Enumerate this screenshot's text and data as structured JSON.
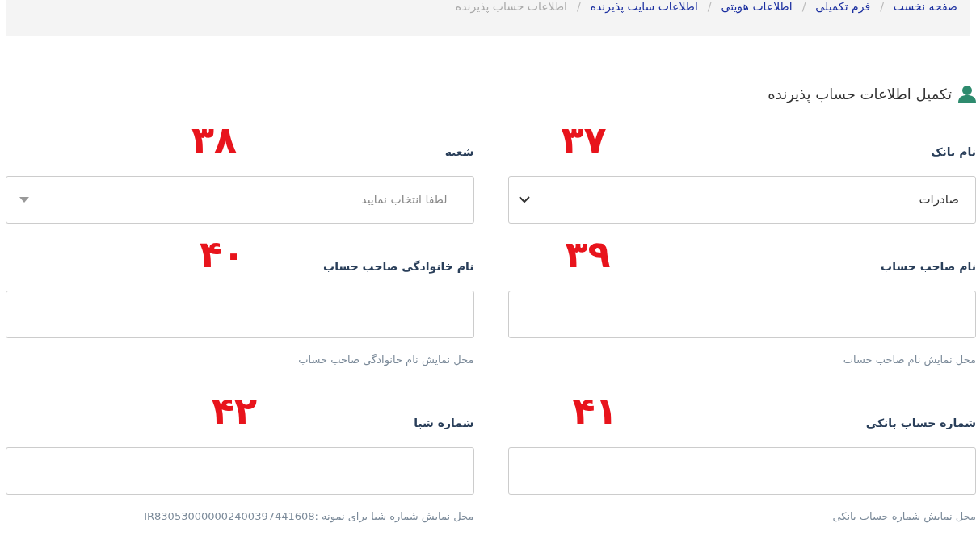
{
  "breadcrumb": [
    {
      "label": "صفحه نخست",
      "current": false
    },
    {
      "label": "فرم تکمیلی",
      "current": false
    },
    {
      "label": "اطلاعات هویتی",
      "current": false
    },
    {
      "label": "اطلاعات سایت پذیرنده",
      "current": false
    },
    {
      "label": "اطلاعات حساب پذیرنده",
      "current": true
    }
  ],
  "separator": "/",
  "section_title": "تکمیل اطلاعات حساب پذیرنده",
  "fields": [
    {
      "kind": "select",
      "label": "نام بانک",
      "annotation": "۳۷",
      "value": "صادرات"
    },
    {
      "kind": "combobox",
      "label": "شعبه",
      "annotation": "۳۸",
      "placeholder": "لطفا انتخاب نمایید"
    },
    {
      "kind": "text",
      "label": "نام صاحب حساب",
      "annotation": "۳۹",
      "hint": "محل نمایش نام صاحب حساب"
    },
    {
      "kind": "text",
      "label": "نام خانوادگی صاحب حساب",
      "annotation": "۴۰",
      "hint": "محل نمایش نام خانوادگی صاحب حساب"
    },
    {
      "kind": "text",
      "label": "شماره حساب بانکی",
      "annotation": "۴۱",
      "hint": "محل نمایش شماره حساب بانکی"
    },
    {
      "kind": "text",
      "label": "شماره شبا",
      "annotation": "۴۲",
      "hint": "محل نمایش شماره شبا برای نمونه :IR830530000002400397441608"
    }
  ]
}
